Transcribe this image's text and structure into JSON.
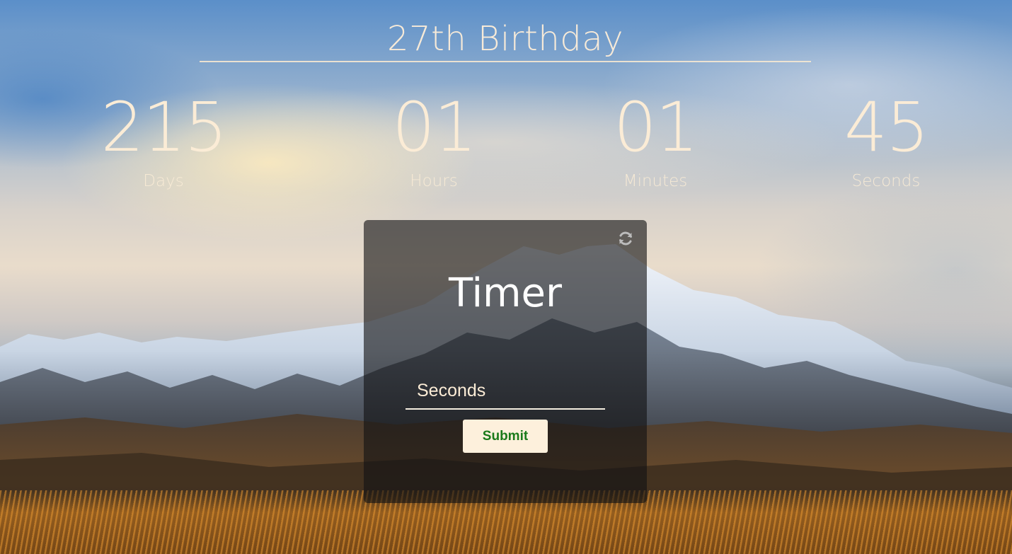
{
  "header": {
    "title": "27th Birthday"
  },
  "countdown": {
    "days": {
      "value": "215",
      "label": "Days"
    },
    "hours": {
      "value": "01",
      "label": "Hours"
    },
    "minutes": {
      "value": "01",
      "label": "Minutes"
    },
    "seconds": {
      "value": "45",
      "label": "Seconds"
    }
  },
  "timer": {
    "title": "Timer",
    "input_placeholder": "Seconds",
    "input_value": "",
    "submit_label": "Submit",
    "refresh_icon": "refresh-icon"
  },
  "colors": {
    "text": "#fbecd6",
    "card_bg": "rgba(18,18,20,0.62)",
    "button_bg": "#fdf0dc",
    "button_text": "#1a7a1a"
  }
}
